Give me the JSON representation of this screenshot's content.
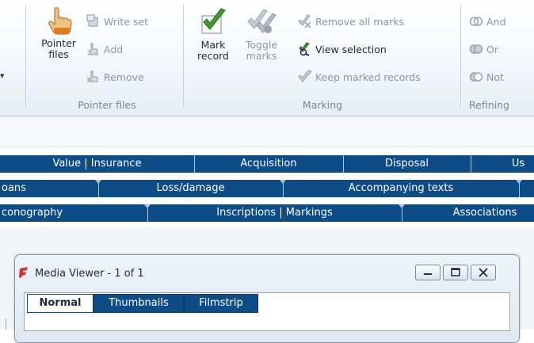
{
  "ribbon": {
    "pointer_files": {
      "big_button_line1": "Pointer",
      "big_button_line2": "files",
      "write_set": "Write set",
      "add": "Add",
      "remove": "Remove",
      "group_label": "Pointer files"
    },
    "marking": {
      "mark_record_line1": "Mark",
      "mark_record_line2": "record",
      "toggle_marks_line1": "Toggle",
      "toggle_marks_line2": "marks",
      "remove_all_marks": "Remove all marks",
      "view_selection": "View selection",
      "keep_marked_records": "Keep marked records",
      "group_label": "Marking"
    },
    "refining": {
      "and": "And",
      "or": "Or",
      "not": "Not",
      "group_label": "Refining"
    }
  },
  "tab_rows": {
    "row1": [
      "Value | Insurance",
      "Acquisition",
      "Disposal",
      "Us"
    ],
    "row2": [
      "oans",
      "Loss/damage",
      "Accompanying texts"
    ],
    "row3": [
      "conography",
      "Inscriptions | Markings",
      "Associations"
    ]
  },
  "media_viewer": {
    "title": "Media Viewer - 1 of 1",
    "tabs": [
      "Normal",
      "Thumbnails",
      "Filmstrip"
    ]
  },
  "colors": {
    "tab_bar": "#0d4c86",
    "check_green": "#3d9a2c",
    "hand_orange": "#e07a20"
  }
}
